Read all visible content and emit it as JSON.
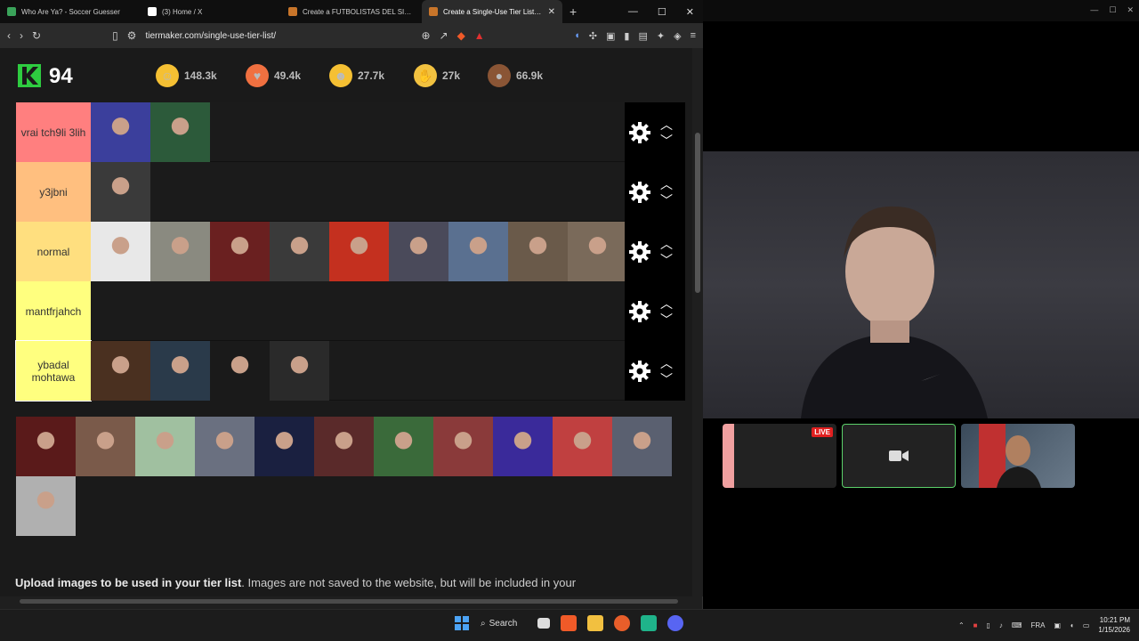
{
  "browser": {
    "tabs": [
      {
        "title": "Who Are Ya? - Soccer Guesser",
        "color": "#3aa35a"
      },
      {
        "title": "(3) Home / X",
        "color": "#ffffff"
      },
      {
        "title": "Create a FUTBOLISTAS DEL SIGLO",
        "color": "#c8752a"
      },
      {
        "title": "Create a Single-Use Tier List (F",
        "color": "#c8752a"
      }
    ],
    "url": "tiermaker.com/single-use-tier-list/"
  },
  "header": {
    "score": "94",
    "reactions": [
      {
        "icon": "grin-emoji-icon",
        "glyph": "☺",
        "count": "148.3k",
        "color": "#f5c033"
      },
      {
        "icon": "heart-eyes-emoji-icon",
        "glyph": "♥",
        "count": "49.4k",
        "color": "#f07040"
      },
      {
        "icon": "laughing-emoji-icon",
        "glyph": "☻",
        "count": "27.7k",
        "color": "#f5c033"
      },
      {
        "icon": "praise-hands-emoji-icon",
        "glyph": "✋",
        "count": "27k",
        "color": "#f2c240"
      },
      {
        "icon": "poop-emoji-icon",
        "glyph": "●",
        "count": "66.9k",
        "color": "#8a5535"
      }
    ]
  },
  "tiers": [
    {
      "label": "vrai tch9li 3lih",
      "color": "#ff7f7f",
      "items": [
        "#3b3f9c",
        "#2c5a3a"
      ]
    },
    {
      "label": "y3jbni",
      "color": "#ffbf7f",
      "items": [
        "#3a3a3a"
      ]
    },
    {
      "label": "normal",
      "color": "#ffdf7f",
      "items": [
        "#e8e8e8",
        "#8a8a80",
        "#6a2020",
        "#3a3a3a",
        "#c4301f",
        "#4a4a5a",
        "#5a7090",
        "#6a5a4a",
        "#7a6a5a"
      ]
    },
    {
      "label": "mantfrjahch",
      "color": "#ffff7f",
      "items": []
    },
    {
      "label": "ybadal mohtawa",
      "color": "#ffff7f",
      "items": [
        "#4a3020",
        "#2a3a4a",
        "#1a1a1a",
        "#2a2a2a"
      ]
    }
  ],
  "pool": {
    "items": [
      "#5a1a1a",
      "#7a5a4a",
      "#a0c0a0",
      "#6a7080",
      "#1a2040",
      "#5a2a2a",
      "#3a6a3a",
      "#8a3a3a",
      "#3a2a9a",
      "#c04040",
      "#5a6070",
      "#b0b0b0"
    ]
  },
  "upload": {
    "bold": "Upload images to be used in your tier list",
    "rest": ". Images are not saved to the website, but will be included in your"
  },
  "call": {
    "live_label": "LIVE"
  },
  "taskbar": {
    "search_label": "Search",
    "lang": "FRA",
    "time": "10:21 PM",
    "date": "1/15/2026"
  }
}
